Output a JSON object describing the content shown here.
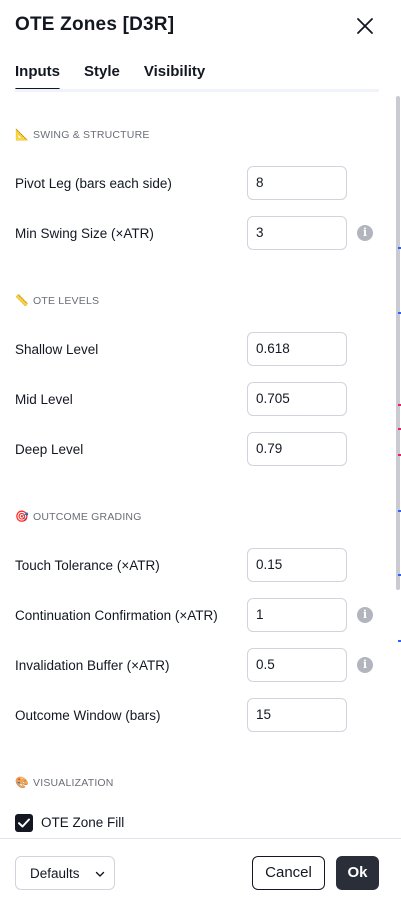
{
  "dialog": {
    "title": "OTE Zones [D3R]"
  },
  "tabs": [
    {
      "label": "Inputs",
      "active": true
    },
    {
      "label": "Style",
      "active": false
    },
    {
      "label": "Visibility",
      "active": false
    }
  ],
  "sections": {
    "swing": {
      "emoji": "📐",
      "title": "Swing & Structure",
      "pivot_leg": {
        "label": "Pivot Leg (bars each side)",
        "value": "8"
      },
      "min_swing": {
        "label": "Min Swing Size (×ATR)",
        "value": "3"
      }
    },
    "ote": {
      "emoji": "📏",
      "title": "OTE Levels",
      "shallow": {
        "label": "Shallow Level",
        "value": "0.618"
      },
      "mid": {
        "label": "Mid Level",
        "value": "0.705"
      },
      "deep": {
        "label": "Deep Level",
        "value": "0.79"
      }
    },
    "outcome": {
      "emoji": "🎯",
      "title": "Outcome Grading",
      "touch": {
        "label": "Touch Tolerance (×ATR)",
        "value": "0.15"
      },
      "continuation": {
        "label": "Continuation Confirmation (×ATR)",
        "value": "1"
      },
      "invalidation": {
        "label": "Invalidation Buffer (×ATR)",
        "value": "0.5"
      },
      "window": {
        "label": "Outcome Window (bars)",
        "value": "15"
      }
    },
    "viz": {
      "emoji": "🎨",
      "title": "Visualization",
      "zone_fill": {
        "label": "OTE Zone Fill",
        "checked": true
      }
    }
  },
  "footer": {
    "defaults_label": "Defaults",
    "cancel_label": "Cancel",
    "ok_label": "Ok"
  },
  "icons": {
    "info": "i",
    "close": "close-icon",
    "chevron": "chevron-down-icon"
  },
  "colors": {
    "text": "#131722",
    "muted": "#6a6d78",
    "border": "#d1d4dc",
    "ok_bg": "#2a2e39",
    "checkbox": "#131722"
  }
}
